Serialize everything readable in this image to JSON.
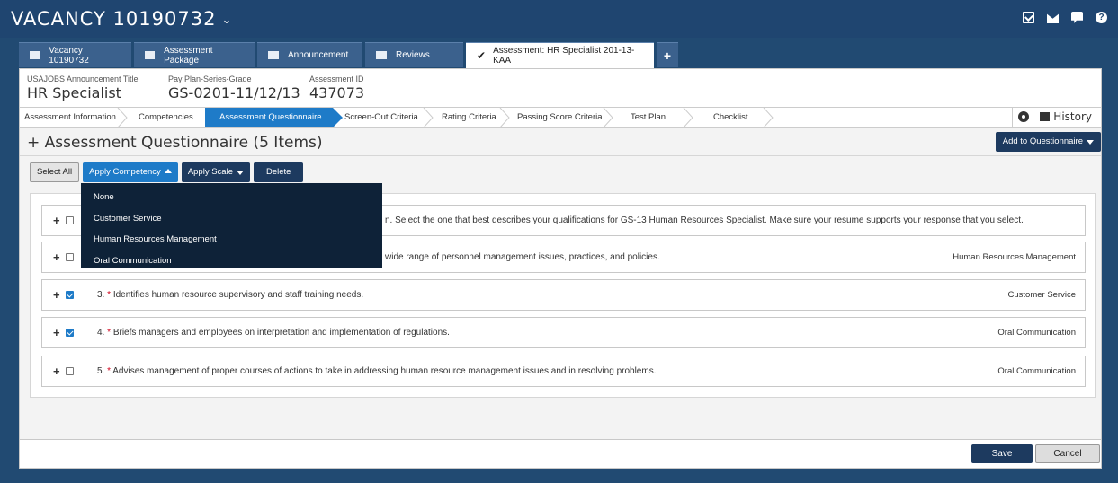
{
  "app": {
    "title": "VACANCY 10190732"
  },
  "top_icons": [
    "checkbox-icon",
    "mail-icon",
    "chat-icon",
    "help-icon"
  ],
  "tabs": [
    {
      "label": "Vacancy 10190732",
      "icon": "folder-icon"
    },
    {
      "label": "Assessment Package",
      "icon": "files-icon"
    },
    {
      "label": "Announcement",
      "icon": "megaphone-icon"
    },
    {
      "label": "Reviews",
      "icon": "thumbs-up-icon"
    },
    {
      "label": "Assessment: HR Specialist 201-13-KAA",
      "icon": "check-icon",
      "active": true
    },
    {
      "label": "+",
      "icon": "plus-icon"
    }
  ],
  "info": {
    "title_label": "USAJOBS Announcement Title",
    "title_value": "HR Specialist",
    "grade_label": "Pay Plan-Series-Grade",
    "grade_value": "GS-0201-11/12/13",
    "id_label": "Assessment ID",
    "id_value": "437073"
  },
  "steps": [
    "Assessment Information",
    "Competencies",
    "Assessment Questionnaire",
    "Screen-Out Criteria",
    "Rating Criteria",
    "Passing Score Criteria",
    "Test Plan",
    "Checklist"
  ],
  "history_label": "History",
  "section": {
    "title": "+ Assessment Questionnaire (5 Items)",
    "add_button": "Add to Questionnaire"
  },
  "toolbar": {
    "select_all": "Select All",
    "apply_competency": "Apply Competency",
    "apply_scale": "Apply Scale",
    "delete": "Delete"
  },
  "dropdown": {
    "items": [
      "None",
      "Customer Service",
      "Human Resources Management",
      "Oral Communication"
    ]
  },
  "questions": [
    {
      "text": "n. Select the one that best describes your qualifications for GS-13 Human Resources Specialist. Make sure your resume supports your response that you select.",
      "competency": "",
      "checked": false
    },
    {
      "text": "wide range of personnel management issues, practices, and policies.",
      "competency": "Human Resources Management",
      "checked": false
    },
    {
      "num": "3.",
      "text": "Identifies human resource supervisory and staff training needs.",
      "competency": "Customer Service",
      "checked": true
    },
    {
      "num": "4.",
      "text": "Briefs managers and employees on interpretation and implementation of regulations.",
      "competency": "Oral Communication",
      "checked": true
    },
    {
      "num": "5.",
      "text": "Advises management of proper courses of actions to take in addressing human resource management issues and in resolving problems.",
      "competency": "Oral Communication",
      "checked": false
    }
  ],
  "footer": {
    "save": "Save",
    "cancel": "Cancel"
  }
}
